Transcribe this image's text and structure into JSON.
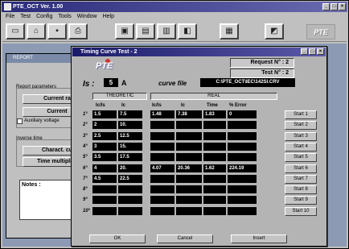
{
  "app": {
    "title": "PTE_OCT  Ver. 1.00"
  },
  "window_controls": {
    "minimize": "_",
    "maximize": "□",
    "close": "×"
  },
  "menu": [
    {
      "label": "File"
    },
    {
      "label": "Test"
    },
    {
      "label": "Config"
    },
    {
      "label": "Tools"
    },
    {
      "label": "Window"
    },
    {
      "label": "Help"
    }
  ],
  "toolbar": {
    "logo": "PTE"
  },
  "report_window": {
    "title": "REPORT",
    "group1_label": "Report parameters",
    "btn1": "Current ra",
    "btn2": "Current",
    "checkbox_label": "Auxiliary voltage",
    "group2_label": "Inverse time",
    "btn3": "Charact. cu",
    "btn4": "Time multiplier",
    "notes_label": "Notes :"
  },
  "dialog": {
    "title": "Timing Curve Test - 2",
    "logo": "PTE",
    "request_no": "Request N° :  2",
    "test_no": "Test N° :  2",
    "is_label": "Is :",
    "is_value": "5",
    "is_unit": "A",
    "curve_file_label": "curve file",
    "curve_file_value": "C:\\PTE_OCT\\IEC\\142SI.CRV",
    "section_theoretic": "THEORETIC",
    "section_real": "REAL",
    "columns": [
      "Ic/Is",
      "Ic",
      "Ic/Is",
      "Ic",
      "Time",
      "% Error"
    ],
    "rows": [
      {
        "label": "1°",
        "cells": [
          "1.5",
          "7.5",
          "1.48",
          "7.38",
          "1.83",
          "0"
        ],
        "start": "Start 1"
      },
      {
        "label": "2°",
        "cells": [
          "2",
          "10.",
          "",
          "",
          "",
          ""
        ],
        "start": "Start 2"
      },
      {
        "label": "3°",
        "cells": [
          "2.5",
          "12.5",
          "",
          "",
          "",
          ""
        ],
        "start": "Start 3"
      },
      {
        "label": "4°",
        "cells": [
          "3",
          "15.",
          "",
          "",
          "",
          ""
        ],
        "start": "Start 4"
      },
      {
        "label": "5°",
        "cells": [
          "3.5",
          "17.5",
          "",
          "",
          "",
          ""
        ],
        "start": "Start 5"
      },
      {
        "label": "6°",
        "cells": [
          "4",
          "20.",
          "4.07",
          "20.36",
          "1.62",
          "224.19"
        ],
        "start": "Start 6"
      },
      {
        "label": "7°",
        "cells": [
          "4.5",
          "22.5",
          "",
          "",
          "",
          ""
        ],
        "start": "Start 7"
      },
      {
        "label": "8°",
        "cells": [
          "",
          "",
          "",
          "",
          "",
          ""
        ],
        "start": "Start 8"
      },
      {
        "label": "9°",
        "cells": [
          "",
          "",
          "",
          "",
          "",
          ""
        ],
        "start": "Start 9"
      },
      {
        "label": "10°",
        "cells": [
          "",
          "",
          "",
          "",
          "",
          ""
        ],
        "start": "Start 10"
      }
    ],
    "buttons": {
      "ok": "OK",
      "cancel": "Cancel",
      "insert": "Insert"
    }
  }
}
